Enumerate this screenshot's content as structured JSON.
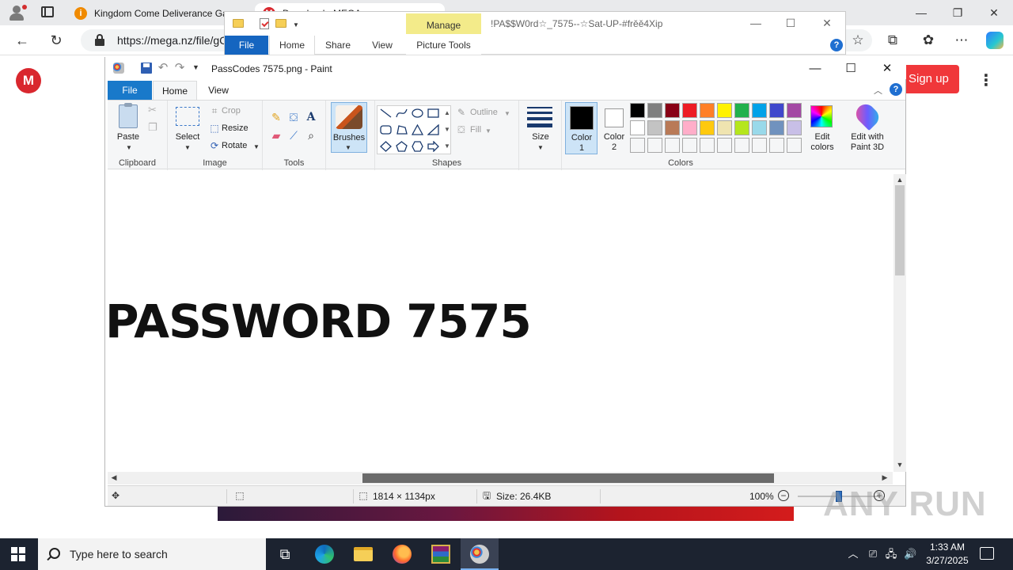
{
  "browser": {
    "tabs": [
      {
        "title": "Kingdom Come Deliverance Ga",
        "favicon": "info-icon"
      },
      {
        "title": "Download - MEGA",
        "favicon": "mega-icon"
      }
    ],
    "url_text": "https://mega.nz/file/gC",
    "window_controls": {
      "minimize": "—",
      "restore": "❐",
      "close": "✕"
    }
  },
  "mega": {
    "logo_letter": "M",
    "signup_label": "Sign up",
    "accent_color": "#f0373a"
  },
  "explorer": {
    "manage_label": "Manage",
    "title": "!PA$$W0rd☆_7575--☆Sat-UP-#frěě4Xip",
    "tabs": {
      "file": "File",
      "home": "Home",
      "share": "Share",
      "view": "View",
      "picture_tools": "Picture Tools"
    }
  },
  "paint": {
    "title": "PassCodes 7575.png - Paint",
    "tabs": {
      "file": "File",
      "home": "Home",
      "view": "View"
    },
    "groups": {
      "clipboard": "Clipboard",
      "image": "Image",
      "tools": "Tools",
      "shapes": "Shapes",
      "colors": "Colors"
    },
    "buttons": {
      "paste": "Paste",
      "crop": "Crop",
      "resize": "Resize",
      "rotate": "Rotate",
      "select": "Select",
      "brushes": "Brushes",
      "outline": "Outline",
      "fill": "Fill",
      "size": "Size",
      "color1_line1": "Color",
      "color1_line2": "1",
      "color2_line1": "Color",
      "color2_line2": "2",
      "edit_colors_line1": "Edit",
      "edit_colors_line2": "colors",
      "paint3d_line1": "Edit with",
      "paint3d_line2": "Paint 3D"
    },
    "color1": "#000000",
    "palette_row1": [
      "#000000",
      "#7f7f7f",
      "#880015",
      "#ed1c24",
      "#ff7f27",
      "#fff200",
      "#22b14c",
      "#00a2e8",
      "#3f48cc",
      "#a349a4"
    ],
    "palette_row2": [
      "#ffffff",
      "#c3c3c3",
      "#b97a57",
      "#ffaec9",
      "#ffc90e",
      "#efe4b0",
      "#b5e61d",
      "#99d9ea",
      "#7092be",
      "#c8bfe7"
    ],
    "canvas_text": "PASSWORD 7575",
    "status": {
      "dimensions": "1814 × 1134px",
      "size": "Size: 26.4KB",
      "zoom": "100%"
    }
  },
  "watermark": "ANY RUN",
  "taskbar": {
    "search_placeholder": "Type here to search",
    "apps": [
      "task-view",
      "edge",
      "file-explorer",
      "firefox",
      "winrar",
      "paint"
    ],
    "time": "1:33 AM",
    "date": "3/27/2025"
  }
}
